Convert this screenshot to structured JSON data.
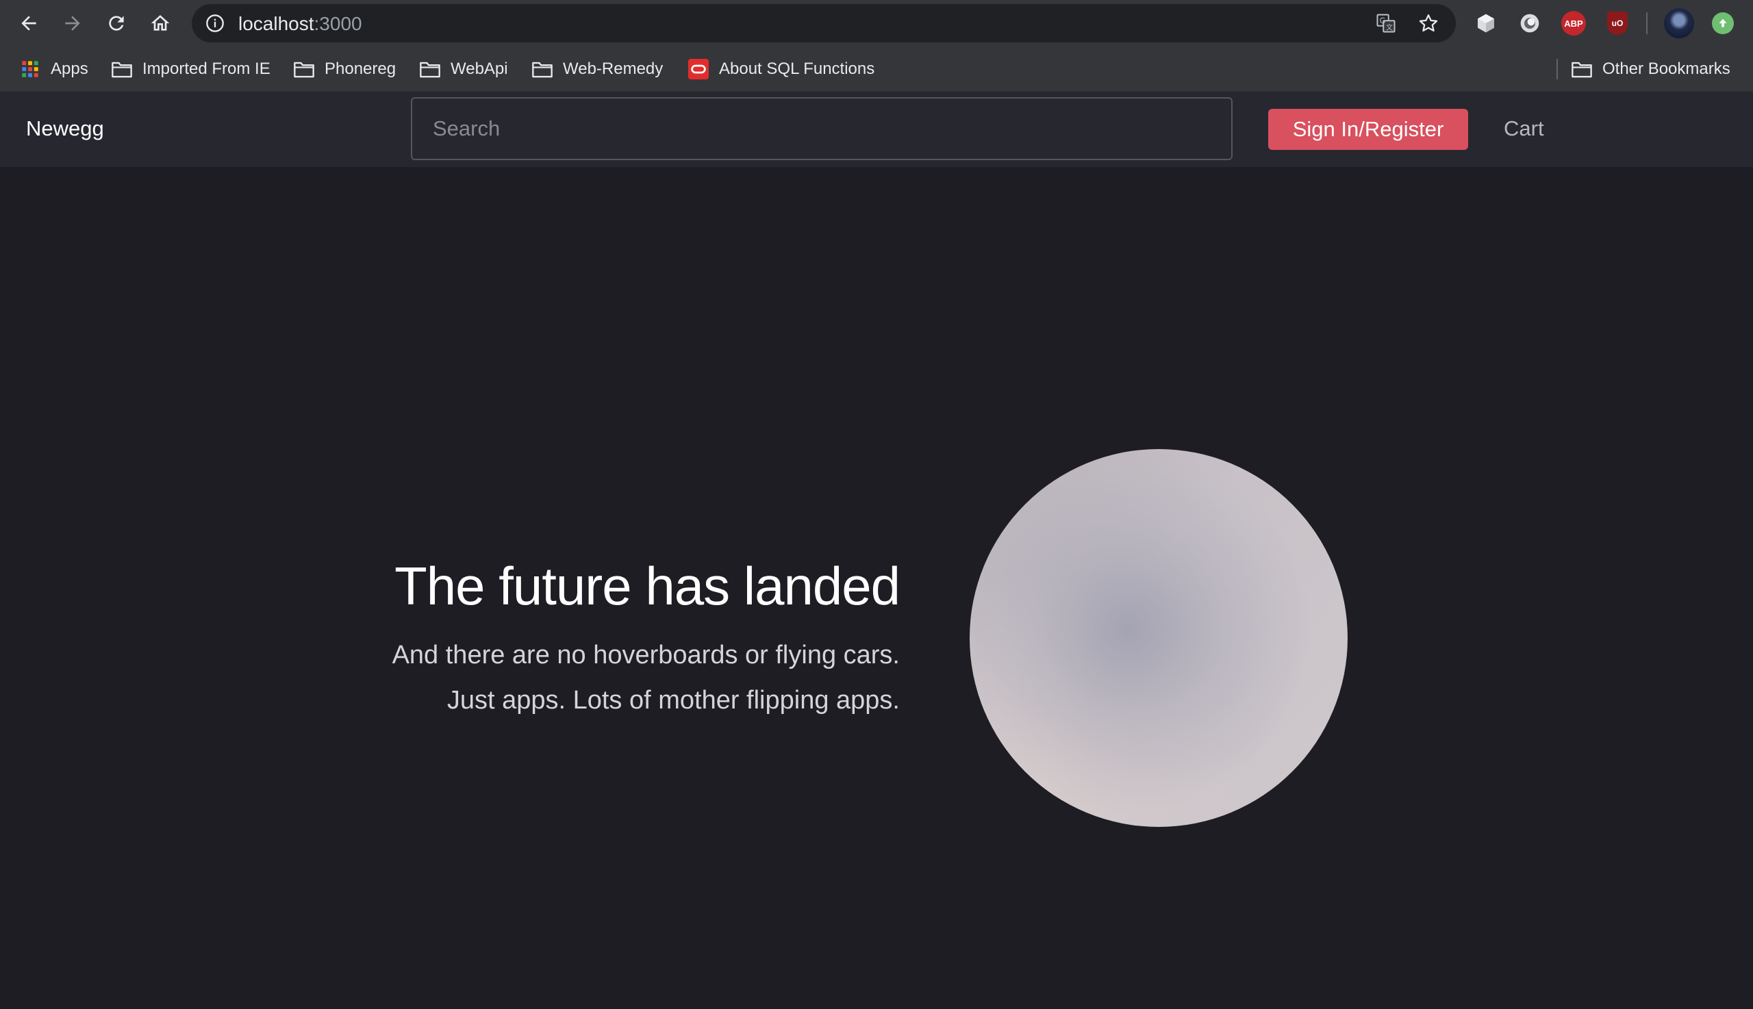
{
  "browser": {
    "url_host": "localhost",
    "url_port": ":3000",
    "bookmarks": [
      {
        "label": "Apps",
        "icon": "apps-grid-icon"
      },
      {
        "label": "Imported From IE",
        "icon": "folder-icon"
      },
      {
        "label": "Phonereg",
        "icon": "folder-icon"
      },
      {
        "label": "WebApi",
        "icon": "folder-icon"
      },
      {
        "label": "Web-Remedy",
        "icon": "folder-icon"
      },
      {
        "label": "About SQL Functions",
        "icon": "oracle-icon"
      }
    ],
    "other_bookmarks": "Other Bookmarks",
    "extensions": {
      "abp_label": "ABP",
      "ublock_label": "uO"
    }
  },
  "site": {
    "brand": "Newegg",
    "search_placeholder": "Search",
    "signin_label": "Sign In/Register",
    "cart_label": "Cart",
    "accent_color": "#d9505e"
  },
  "hero": {
    "title": "The future has landed",
    "subtitle_line1": "And there are no hoverboards or flying cars.",
    "subtitle_line2": "Just apps. Lots of mother flipping apps."
  }
}
